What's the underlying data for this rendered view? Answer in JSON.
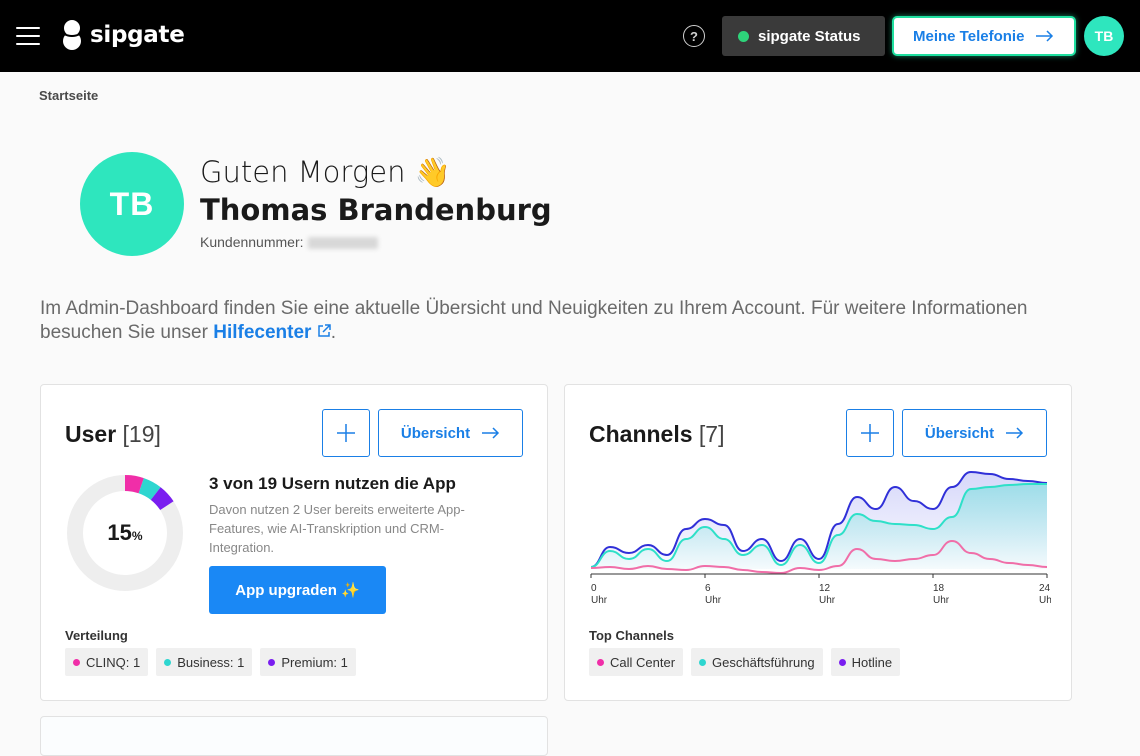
{
  "header": {
    "logo_text": "sipgate",
    "help_icon": "?",
    "status_label": "sipgate Status",
    "telefonie_label": "Meine Telefonie",
    "avatar_initials": "TB",
    "colors": {
      "status_ok": "#2ed47a",
      "accent_green": "#1fe0a0",
      "link_blue": "#1a7fe6"
    }
  },
  "breadcrumb": "Startseite",
  "profile": {
    "initials": "TB",
    "greeting": "Guten Morgen 👋",
    "name": "Thomas Brandenburg",
    "customer_label": "Kundennummer:"
  },
  "intro": {
    "text": "Im Admin-Dashboard finden Sie eine aktuelle Übersicht und Neuigkeiten zu Ihrem Account. Für weitere Informationen besuchen Sie unser ",
    "link": "Hilfecenter",
    "tail": "."
  },
  "users_card": {
    "title": "User",
    "count": "[19]",
    "overview_label": "Übersicht",
    "percent": "15",
    "percent_unit": "%",
    "app_title": "3 von 19 Usern nutzen die App",
    "app_desc": "Davon nutzen 2 User bereits erweiterte App-Features, wie AI-Transkription und CRM-Integration.",
    "upgrade_label": "App upgraden ✨",
    "distribution_label": "Verteilung",
    "distribution": [
      {
        "label": "CLINQ: 1",
        "color": "#f02ea8"
      },
      {
        "label": "Business: 1",
        "color": "#2ed6d0"
      },
      {
        "label": "Premium: 1",
        "color": "#7a1ef0"
      }
    ]
  },
  "channels_card": {
    "title": "Channels",
    "count": "[7]",
    "overview_label": "Übersicht",
    "top_label": "Top Channels",
    "top": [
      {
        "label": "Call Center",
        "color": "#f02ea8"
      },
      {
        "label": "Geschäftsführung",
        "color": "#2ed6d0"
      },
      {
        "label": "Hotline",
        "color": "#7a1ef0"
      }
    ]
  },
  "chart_data": {
    "type": "area",
    "x": [
      0,
      1,
      2,
      3,
      4,
      5,
      6,
      7,
      8,
      9,
      10,
      11,
      12,
      13,
      14,
      15,
      16,
      17,
      18,
      19,
      20,
      21,
      22,
      23,
      24
    ],
    "x_ticks": [
      {
        "value": 0,
        "label": "0",
        "unit": "Uhr"
      },
      {
        "value": 6,
        "label": "6",
        "unit": "Uhr"
      },
      {
        "value": 12,
        "label": "12",
        "unit": "Uhr"
      },
      {
        "value": 18,
        "label": "18",
        "unit": "Uhr"
      },
      {
        "value": 24,
        "label": "24",
        "unit": "Uhr"
      }
    ],
    "ylim": [
      0,
      100
    ],
    "series": [
      {
        "color": "#3030d8",
        "fill": true,
        "values": [
          2,
          22,
          16,
          24,
          14,
          40,
          50,
          44,
          18,
          30,
          8,
          30,
          10,
          45,
          72,
          60,
          82,
          68,
          60,
          82,
          97,
          95,
          90,
          88,
          86
        ]
      },
      {
        "color": "#2ee0c8",
        "fill": true,
        "values": [
          2,
          18,
          10,
          20,
          8,
          30,
          42,
          30,
          14,
          24,
          4,
          24,
          6,
          34,
          55,
          48,
          45,
          44,
          40,
          52,
          80,
          82,
          84,
          85,
          85
        ]
      },
      {
        "color": "#f06ea8",
        "fill": false,
        "values": [
          1,
          2,
          0,
          3,
          0,
          -1,
          3,
          2,
          -1,
          -3,
          -4,
          1,
          -1,
          3,
          20,
          10,
          8,
          10,
          14,
          28,
          16,
          10,
          6,
          4,
          2
        ]
      }
    ]
  }
}
